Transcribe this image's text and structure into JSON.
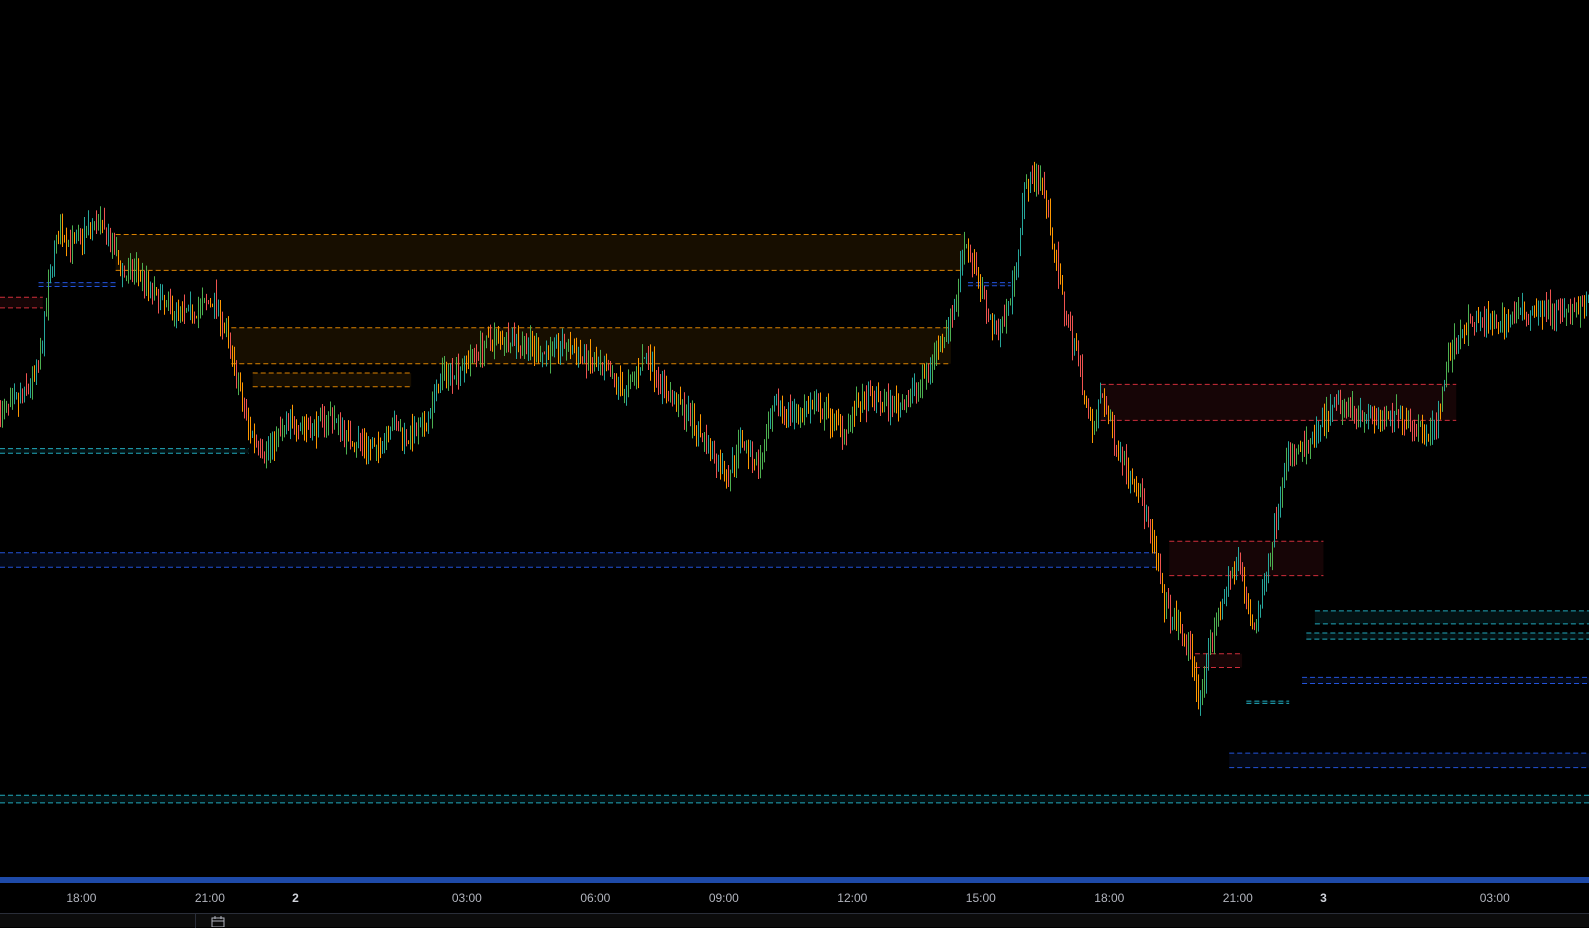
{
  "chart_data": {
    "type": "candlestick",
    "title": "",
    "xlabel": "",
    "ylabel": "",
    "time_axis": {
      "ticks": [
        {
          "label": "18:00",
          "t": 0.0,
          "bold": false
        },
        {
          "label": "21:00",
          "t": 3.0,
          "bold": false
        },
        {
          "label": "2",
          "t": 5.0,
          "bold": true
        },
        {
          "label": "03:00",
          "t": 9.0,
          "bold": false
        },
        {
          "label": "06:00",
          "t": 12.0,
          "bold": false
        },
        {
          "label": "09:00",
          "t": 15.0,
          "bold": false
        },
        {
          "label": "12:00",
          "t": 18.0,
          "bold": false
        },
        {
          "label": "15:00",
          "t": 21.0,
          "bold": false
        },
        {
          "label": "18:00",
          "t": 24.0,
          "bold": false
        },
        {
          "label": "21:00",
          "t": 27.0,
          "bold": false
        },
        {
          "label": "3",
          "t": 29.0,
          "bold": true
        },
        {
          "label": "03:00",
          "t": 33.0,
          "bold": false
        }
      ],
      "range": [
        -1.9,
        35.2
      ]
    },
    "price_range": [
      0,
      100
    ],
    "price_path": [
      [
        -1.9,
        55
      ],
      [
        -1.4,
        57
      ],
      [
        -1.0,
        61
      ],
      [
        -0.7,
        75
      ],
      [
        -0.5,
        79
      ],
      [
        -0.2,
        77
      ],
      [
        0.1,
        79
      ],
      [
        0.4,
        80
      ],
      [
        0.7,
        77
      ],
      [
        1.0,
        73
      ],
      [
        1.3,
        74
      ],
      [
        1.6,
        71
      ],
      [
        2.0,
        69
      ],
      [
        2.4,
        68
      ],
      [
        2.8,
        69
      ],
      [
        3.1,
        70
      ],
      [
        3.4,
        65
      ],
      [
        3.6,
        60
      ],
      [
        3.9,
        53
      ],
      [
        4.3,
        50
      ],
      [
        4.7,
        53
      ],
      [
        5.0,
        54
      ],
      [
        5.4,
        53
      ],
      [
        5.8,
        55
      ],
      [
        6.2,
        52
      ],
      [
        6.6,
        51
      ],
      [
        6.9,
        50
      ],
      [
        7.2,
        54
      ],
      [
        7.6,
        52
      ],
      [
        8.0,
        53
      ],
      [
        8.4,
        60
      ],
      [
        8.8,
        61
      ],
      [
        9.2,
        63
      ],
      [
        9.6,
        65
      ],
      [
        10.0,
        65
      ],
      [
        10.4,
        64
      ],
      [
        10.8,
        63
      ],
      [
        11.3,
        64
      ],
      [
        11.8,
        62
      ],
      [
        12.3,
        60
      ],
      [
        12.7,
        58
      ],
      [
        13.2,
        63
      ],
      [
        13.6,
        58
      ],
      [
        14.0,
        56
      ],
      [
        14.4,
        53
      ],
      [
        14.8,
        49
      ],
      [
        15.1,
        47
      ],
      [
        15.4,
        52
      ],
      [
        15.8,
        48
      ],
      [
        16.2,
        56
      ],
      [
        16.6,
        55
      ],
      [
        17.0,
        56
      ],
      [
        17.4,
        55
      ],
      [
        17.8,
        53
      ],
      [
        18.1,
        56
      ],
      [
        18.5,
        57
      ],
      [
        18.9,
        56
      ],
      [
        19.3,
        57
      ],
      [
        19.7,
        60
      ],
      [
        20.0,
        64
      ],
      [
        20.4,
        69
      ],
      [
        20.6,
        78
      ],
      [
        20.8,
        75
      ],
      [
        21.0,
        71
      ],
      [
        21.3,
        66
      ],
      [
        21.6,
        68
      ],
      [
        21.8,
        74
      ],
      [
        22.0,
        84
      ],
      [
        22.2,
        86
      ],
      [
        22.4,
        86
      ],
      [
        22.6,
        80
      ],
      [
        22.8,
        73
      ],
      [
        23.0,
        67
      ],
      [
        23.2,
        64
      ],
      [
        23.4,
        58
      ],
      [
        23.6,
        52
      ],
      [
        23.8,
        58
      ],
      [
        24.1,
        52
      ],
      [
        24.4,
        48
      ],
      [
        24.7,
        45
      ],
      [
        25.0,
        38
      ],
      [
        25.3,
        30
      ],
      [
        25.6,
        27
      ],
      [
        25.9,
        24
      ],
      [
        26.1,
        17
      ],
      [
        26.4,
        26
      ],
      [
        26.7,
        32
      ],
      [
        27.0,
        36
      ],
      [
        27.2,
        30
      ],
      [
        27.4,
        27
      ],
      [
        27.6,
        32
      ],
      [
        27.9,
        42
      ],
      [
        28.1,
        49
      ],
      [
        28.4,
        50
      ],
      [
        28.7,
        51
      ],
      [
        29.0,
        54
      ],
      [
        29.3,
        56
      ],
      [
        29.6,
        56
      ],
      [
        30.0,
        55
      ],
      [
        30.4,
        54
      ],
      [
        30.8,
        55
      ],
      [
        31.2,
        53
      ],
      [
        31.6,
        53
      ],
      [
        31.9,
        62
      ],
      [
        32.2,
        66
      ],
      [
        32.6,
        67
      ],
      [
        33.0,
        67
      ],
      [
        33.5,
        68
      ],
      [
        34.0,
        69
      ],
      [
        34.6,
        68
      ],
      [
        35.2,
        69
      ]
    ],
    "zones": [
      {
        "kind": "supply",
        "t1": 0.8,
        "t2": 20.6,
        "top": 78.5,
        "bottom": 73.8,
        "color": "#ff9800"
      },
      {
        "kind": "supply",
        "t1": 3.5,
        "t2": 20.3,
        "top": 66.3,
        "bottom": 61.6,
        "color": "#ff9800"
      },
      {
        "kind": "supply",
        "t1": 4.0,
        "t2": 7.7,
        "top": 60.4,
        "bottom": 58.6,
        "color": "#ff9800"
      },
      {
        "kind": "supply",
        "t1": -1.9,
        "t2": -0.9,
        "top": 70.3,
        "bottom": 68.9,
        "color": "#f23645"
      },
      {
        "kind": "supply",
        "t1": 23.8,
        "t2": 32.1,
        "top": 58.9,
        "bottom": 54.2,
        "color": "#f23645"
      },
      {
        "kind": "supply",
        "t1": 25.4,
        "t2": 29.0,
        "top": 38.4,
        "bottom": 33.9,
        "color": "#f23645"
      },
      {
        "kind": "supply",
        "t1": 26.0,
        "t2": 27.1,
        "top": 23.7,
        "bottom": 21.9,
        "color": "#f23645"
      },
      {
        "kind": "demand",
        "t1": -1.9,
        "t2": 25.1,
        "top": 36.9,
        "bottom": 35.0,
        "color": "#2962ff"
      },
      {
        "kind": "demand",
        "t1": 26.8,
        "t2": 35.2,
        "top": 10.7,
        "bottom": 8.8,
        "color": "#2962ff"
      },
      {
        "kind": "demand",
        "t1": 28.5,
        "t2": 35.2,
        "top": 20.6,
        "bottom": 19.8,
        "color": "#2962ff"
      },
      {
        "kind": "demand",
        "t1": -1.0,
        "t2": 0.8,
        "top": 72.2,
        "bottom": 71.7,
        "color": "#2962ff"
      },
      {
        "kind": "demand",
        "t1": 20.7,
        "t2": 21.7,
        "top": 72.2,
        "bottom": 71.8,
        "color": "#2962ff"
      },
      {
        "kind": "support",
        "t1": -1.9,
        "t2": 3.9,
        "top": 50.5,
        "bottom": 49.9,
        "color": "#26c6da"
      },
      {
        "kind": "support",
        "t1": 28.8,
        "t2": 35.2,
        "top": 29.3,
        "bottom": 27.6,
        "color": "#26c6da"
      },
      {
        "kind": "support",
        "t1": 28.6,
        "t2": 35.2,
        "top": 26.4,
        "bottom": 25.6,
        "color": "#26c6da"
      },
      {
        "kind": "support",
        "t1": 27.2,
        "t2": 28.2,
        "top": 17.5,
        "bottom": 17.2,
        "color": "#26c6da"
      },
      {
        "kind": "support",
        "t1": -1.9,
        "t2": 35.2,
        "top": 5.2,
        "bottom": 4.2,
        "color": "#26c6da"
      }
    ],
    "colors": {
      "background": "#000000",
      "bull": "#26a69a",
      "bull_bright": "#4caf50",
      "bear": "#ef5350",
      "bear_orange": "#ff9800",
      "axis_bar": "#1e4aa8",
      "axis_text": "#b2b5be"
    },
    "grid": false,
    "legend": "none"
  },
  "bottom_bar": {
    "calendar_icon": "calendar-icon"
  }
}
